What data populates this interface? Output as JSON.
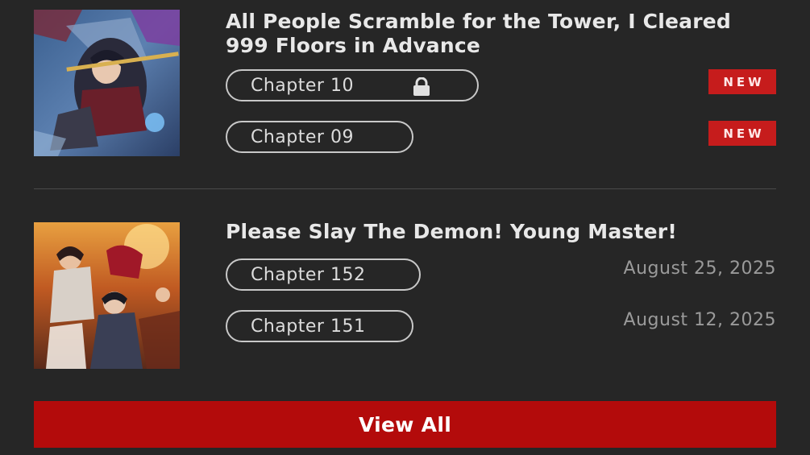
{
  "entries": [
    {
      "title": "All People Scramble for the Tower, I Cleared 999 Floors in Advance",
      "chapters": [
        {
          "label": "Chapter 10",
          "locked": true,
          "badge": "NEW"
        },
        {
          "label": "Chapter 09",
          "locked": false,
          "badge": "NEW"
        }
      ]
    },
    {
      "title": "Please Slay The Demon! Young Master!",
      "chapters": [
        {
          "label": "Chapter 152",
          "date": "August 25, 2025"
        },
        {
          "label": "Chapter 151",
          "date": "August 12, 2025"
        }
      ]
    }
  ],
  "view_all_label": "View All",
  "colors": {
    "background": "#262626",
    "accent": "#b30b0b",
    "badge": "#c61c1c"
  },
  "icons": {
    "lock": "lock-icon"
  }
}
